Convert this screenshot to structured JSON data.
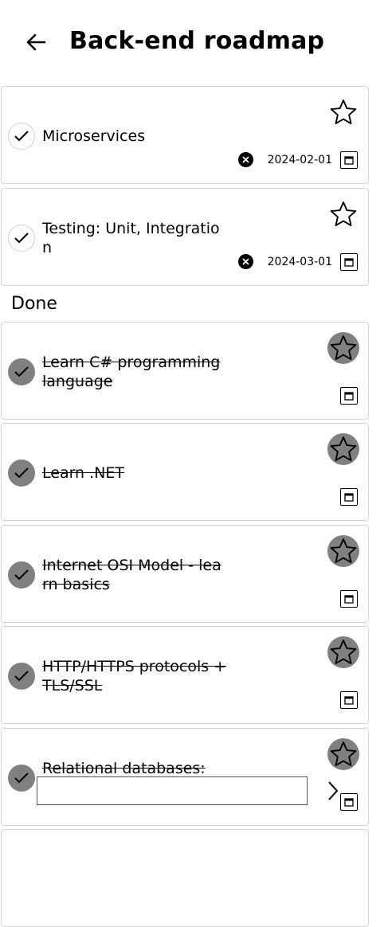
{
  "header": {
    "title": "Back-end roadmap",
    "back_icon": "arrow-left-icon"
  },
  "pending": [
    {
      "text": "Microservices",
      "date": "2024-02-01"
    },
    {
      "text": "Testing: Unit, Integration",
      "date": "2024-03-01"
    }
  ],
  "done_label": "Done",
  "done": [
    {
      "text": "Learn C# programming language"
    },
    {
      "text": "Learn .NET"
    },
    {
      "text": "Internet OSI Model - learn basics"
    },
    {
      "text": "HTTP/HTTPS protocols +TLS/SSL"
    },
    {
      "text": "Relational databases:",
      "edit_value": ""
    }
  ],
  "colors": {
    "done_fill": "#808080",
    "card_border": "#d6d6d6"
  }
}
